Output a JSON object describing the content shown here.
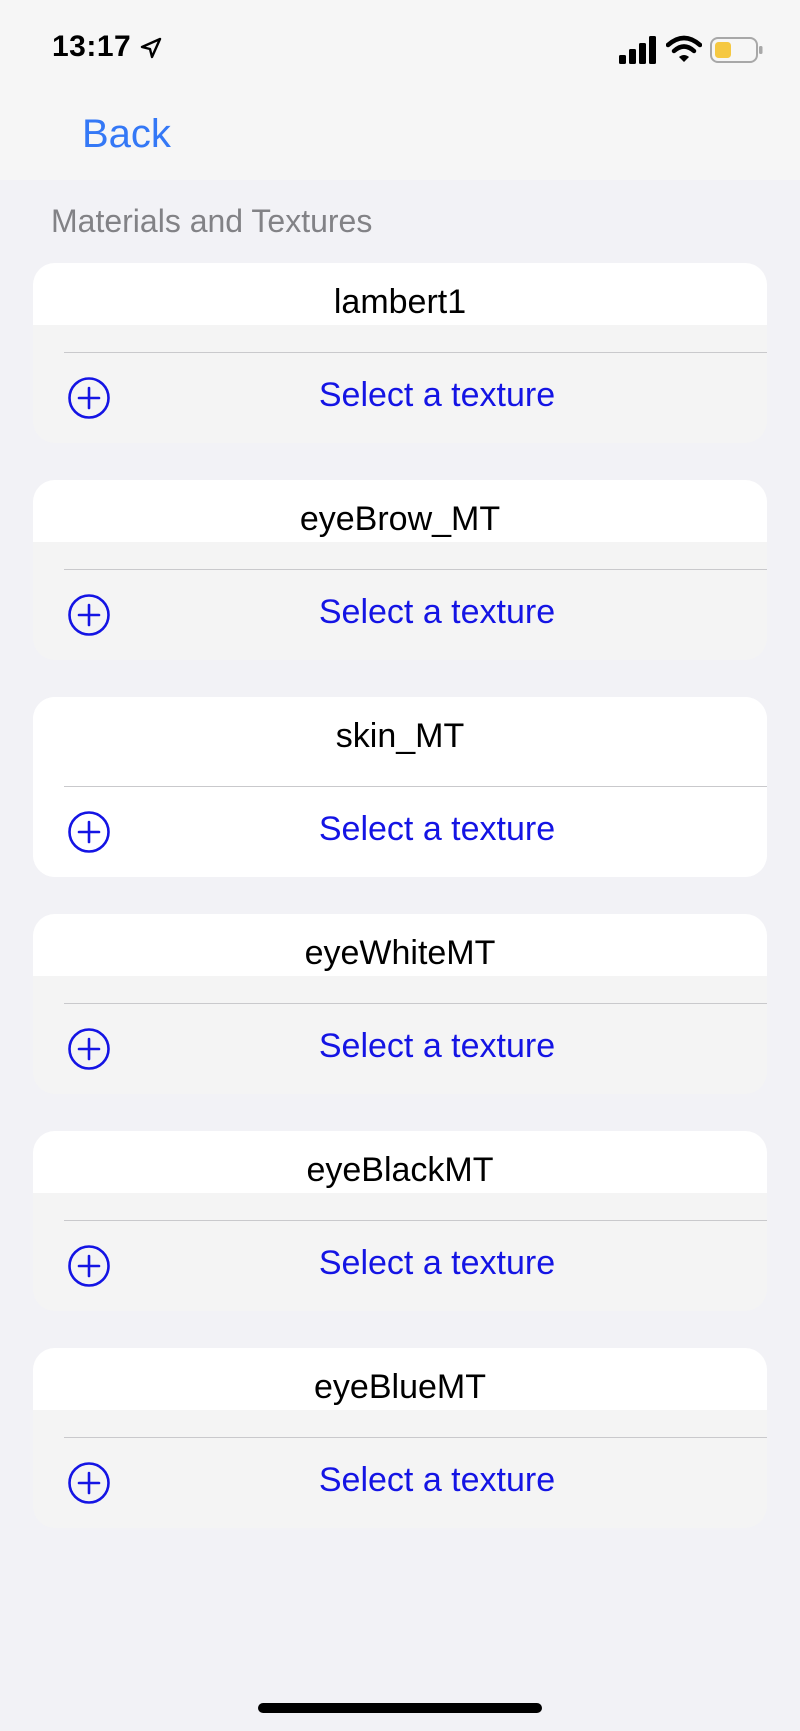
{
  "status_bar": {
    "time": "13:17",
    "icons": [
      "location-arrow-icon",
      "cellular-signal-icon",
      "wifi-icon",
      "battery-icon"
    ],
    "battery_color": "#f5c842"
  },
  "nav": {
    "back_label": "Back",
    "accent_color": "#3478f6"
  },
  "section": {
    "header": "Materials and Textures"
  },
  "materials": [
    {
      "name": "lambert1",
      "action_label": "Select a texture",
      "action_icon": "plus-circle-icon"
    },
    {
      "name": "eyeBrow_MT",
      "action_label": "Select a texture",
      "action_icon": "plus-circle-icon"
    },
    {
      "name": "skin_MT",
      "action_label": "Select a texture",
      "action_icon": "plus-circle-icon"
    },
    {
      "name": "eyeWhiteMT",
      "action_label": "Select a texture",
      "action_icon": "plus-circle-icon"
    },
    {
      "name": "eyeBlackMT",
      "action_label": "Select a texture",
      "action_icon": "plus-circle-icon"
    },
    {
      "name": "eyeBlueMT",
      "action_label": "Select a texture",
      "action_icon": "plus-circle-icon"
    }
  ],
  "colors": {
    "action_text": "#1414e4",
    "section_header": "#828286",
    "background": "#f2f2f6"
  }
}
